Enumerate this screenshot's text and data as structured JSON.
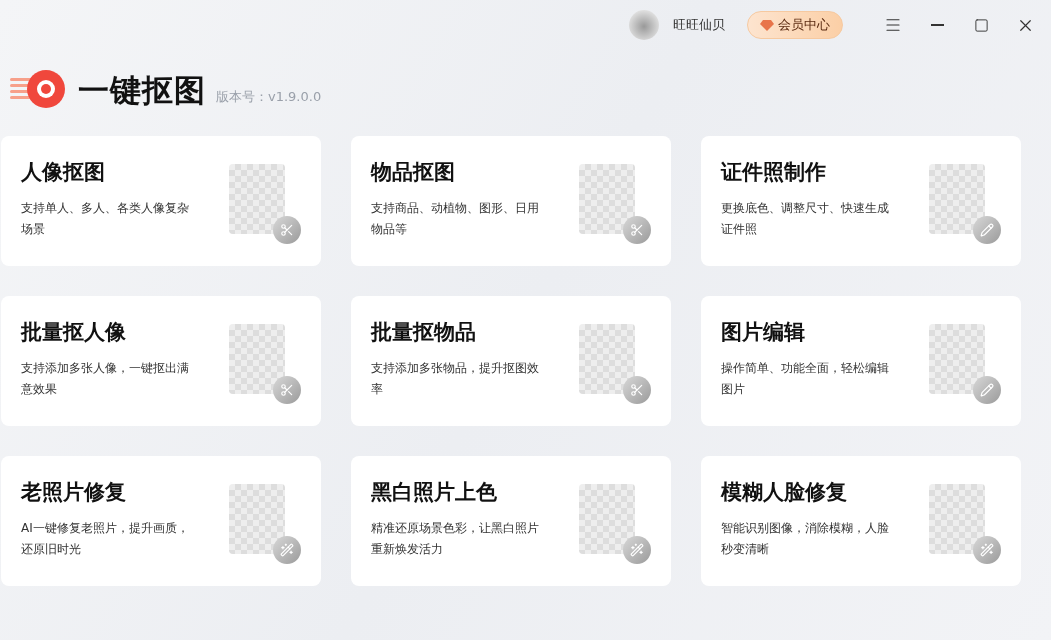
{
  "user": {
    "name": "旺旺仙贝"
  },
  "vip_button": {
    "label": "会员中心"
  },
  "app": {
    "title": "一键抠图",
    "version": "版本号：v1.9.0.0"
  },
  "cards": [
    {
      "title": "人像抠图",
      "description": "支持单人、多人、各类人像复杂场景",
      "kind": "cut"
    },
    {
      "title": "物品抠图",
      "description": "支持商品、动植物、图形、日用物品等",
      "kind": "cut"
    },
    {
      "title": "证件照制作",
      "description": "更换底色、调整尺寸、快速生成证件照",
      "kind": "edit"
    },
    {
      "title": "批量抠人像",
      "description": "支持添加多张人像，一键抠出满意效果",
      "kind": "cut"
    },
    {
      "title": "批量抠物品",
      "description": "支持添加多张物品，提升抠图效率",
      "kind": "cut"
    },
    {
      "title": "图片编辑",
      "description": "操作简单、功能全面，轻松编辑图片",
      "kind": "edit"
    },
    {
      "title": "老照片修复",
      "description": "AI一键修复老照片，提升画质，还原旧时光",
      "kind": "repair"
    },
    {
      "title": "黑白照片上色",
      "description": "精准还原场景色彩，让黑白照片重新焕发活力",
      "kind": "repair"
    },
    {
      "title": "模糊人脸修复",
      "description": "智能识别图像，消除模糊，人脸秒变清晰",
      "kind": "repair"
    }
  ]
}
